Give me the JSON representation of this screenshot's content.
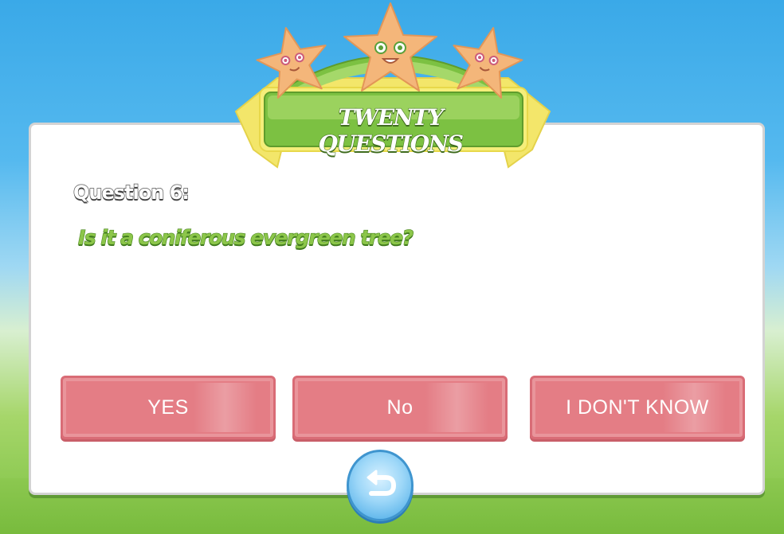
{
  "banner": {
    "title": "TWENTY QUESTIONS"
  },
  "question": {
    "label": "Question 6:",
    "text": "Is it a coniferous evergreen tree?"
  },
  "answers": {
    "yes": "YES",
    "no": "No",
    "dont_know": "I DON'T KNOW"
  },
  "icons": {
    "back": "back-arrow-icon",
    "stars": "star-mascot-icon"
  },
  "colors": {
    "button": "#e47d85",
    "banner_green": "#8cc64a",
    "question_text": "#8cc64a",
    "back_button": "#5bb4ea"
  }
}
